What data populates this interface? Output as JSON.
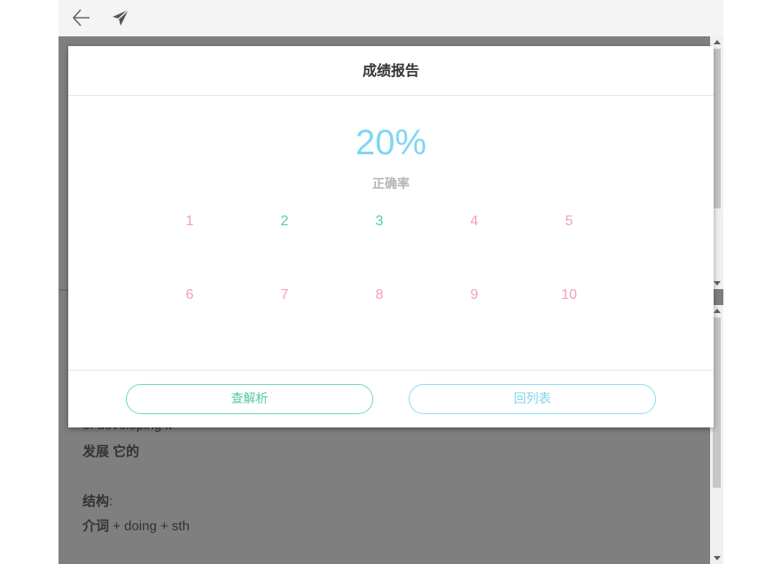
{
  "toolbar": {
    "back_icon": "arrow-left-icon",
    "send_icon": "paper-plane-icon"
  },
  "background": {
    "partial_line": "of developing it",
    "line1": "发展 它的",
    "line2_label": "结构",
    "line2_colon": ":",
    "line3_a": "介词",
    "line3_b": " + doing + sth"
  },
  "modal": {
    "title": "成绩报告",
    "score": "20%",
    "score_label": "正确率",
    "questions": [
      {
        "number": "1",
        "status": "wrong"
      },
      {
        "number": "2",
        "status": "right"
      },
      {
        "number": "3",
        "status": "right"
      },
      {
        "number": "4",
        "status": "wrong"
      },
      {
        "number": "5",
        "status": "wrong"
      },
      {
        "number": "6",
        "status": "wrong"
      },
      {
        "number": "7",
        "status": "wrong"
      },
      {
        "number": "8",
        "status": "wrong"
      },
      {
        "number": "9",
        "status": "wrong"
      },
      {
        "number": "10",
        "status": "wrong"
      }
    ],
    "buttons": {
      "analysis": "查解析",
      "back_to_list": "回列表"
    }
  },
  "colors": {
    "accent_blue": "#7fd6f3",
    "correct_green": "#4ecdab",
    "wrong_pink": "#f4a0b4"
  }
}
